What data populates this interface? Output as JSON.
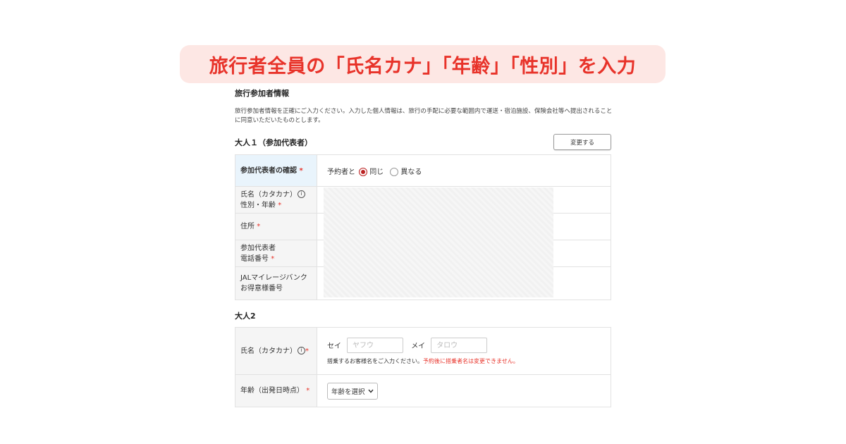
{
  "banner": {
    "text": "旅行者全員の「氏名カナ」「年齢」「性別」を入力"
  },
  "section": {
    "title": "旅行参加者情報",
    "description": "旅行参加者情報を正確にご入力ください。入力した個人情報は、旅行の手配に必要な範囲内で運送・宿泊施設、保険会社等へ提出されることに同意いただいたものとします。"
  },
  "adult1": {
    "title": "大人１（参加代表者）",
    "change_button": "変更する",
    "confirm_label": "参加代表者の確認",
    "confirm_prefix": "予約者と",
    "option_same": "同じ",
    "option_diff": "異なる",
    "name_label_1": "氏名（カタカナ）",
    "name_label_2": "性別・年齢",
    "address_label": "住所",
    "phone_label_1": "参加代表者",
    "phone_label_2": "電話番号",
    "jal_label_1": "JALマイレージバンク",
    "jal_label_2": "お得意様番号"
  },
  "adult2": {
    "title": "大人2",
    "name_label": "氏名（カタカナ）",
    "sei_label": "セイ",
    "sei_placeholder": "ヤフウ",
    "mei_label": "メイ",
    "mei_placeholder": "タロウ",
    "note": "搭乗するお客様名をご入力ください。",
    "note_warning": "予約後に搭乗者名は変更できません。",
    "age_label": "年齢（出発日時点）",
    "age_select": "年齢を選択"
  },
  "required_mark": "*",
  "info_icon": "i",
  "colors": {
    "accent": "#e8332a",
    "banner_bg": "#fde7e4",
    "radio": "#b22222"
  }
}
